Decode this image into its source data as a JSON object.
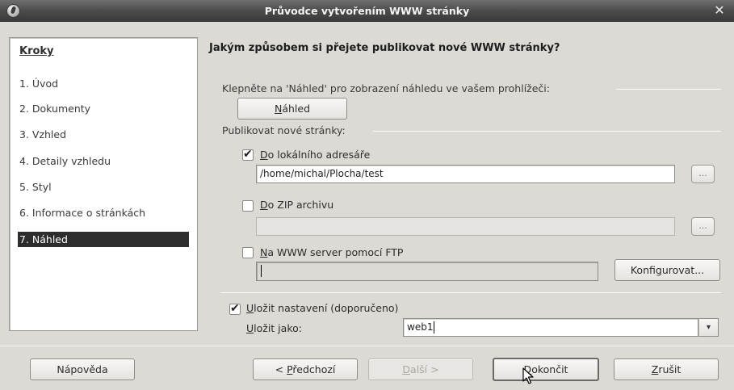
{
  "window": {
    "title": "Průvodce vytvořením WWW stránky",
    "close_glyph": "✕"
  },
  "sidebar": {
    "header": "Kroky",
    "steps": [
      "1. Úvod",
      "2. Dokumenty",
      "3. Vzhled",
      "4. Detaily vzhledu",
      "5. Styl",
      "6. Informace o stránkách",
      "7. Náhled"
    ],
    "active_index": 6
  },
  "main": {
    "heading": "Jakým způsobem si přejete publikovat nové WWW stránky?",
    "preview_section": {
      "label": "Klepněte na 'Náhled' pro zobrazení náhledu ve vašem prohlížeči:",
      "button": {
        "mnemonic": "N",
        "rest": "áhled"
      }
    },
    "publish_section": {
      "label": "Publikovat nové stránky:",
      "local": {
        "checked": true,
        "mnemonic": "D",
        "rest": "o lokálního adresáře",
        "path": "/home/michal/Plocha/test",
        "browse": "..."
      },
      "zip": {
        "checked": false,
        "mnemonic": "D",
        "rest": "o ZIP archivu",
        "path": "",
        "browse": "..."
      },
      "ftp": {
        "checked": false,
        "mnemonic": "N",
        "rest": "a WWW server pomocí FTP",
        "path": "",
        "configure": {
          "pre": "Konfi",
          "mnemonic": "g",
          "rest": "urovat..."
        }
      }
    },
    "save_settings": {
      "checked": true,
      "label": {
        "mnemonic": "U",
        "rest": "ložit nastavení (doporučeno)"
      },
      "save_as": {
        "mnemonic": "U",
        "rest": "ložit jako:"
      },
      "value": "web1",
      "arrow": "▾"
    }
  },
  "footer": {
    "help": "Nápověda",
    "back": {
      "pre": "< ",
      "mnemonic": "P",
      "rest": "ředchozí"
    },
    "next": {
      "mnemonic": "D",
      "rest": "alší >"
    },
    "finish": {
      "mnemonic": "D",
      "rest": "okončit"
    },
    "cancel": {
      "mnemonic": "Z",
      "rest": "rušit"
    }
  },
  "colors": {
    "titlebar": "#4c4c4c",
    "selection": "#2d2d2d",
    "window_bg": "#dcdad5"
  }
}
